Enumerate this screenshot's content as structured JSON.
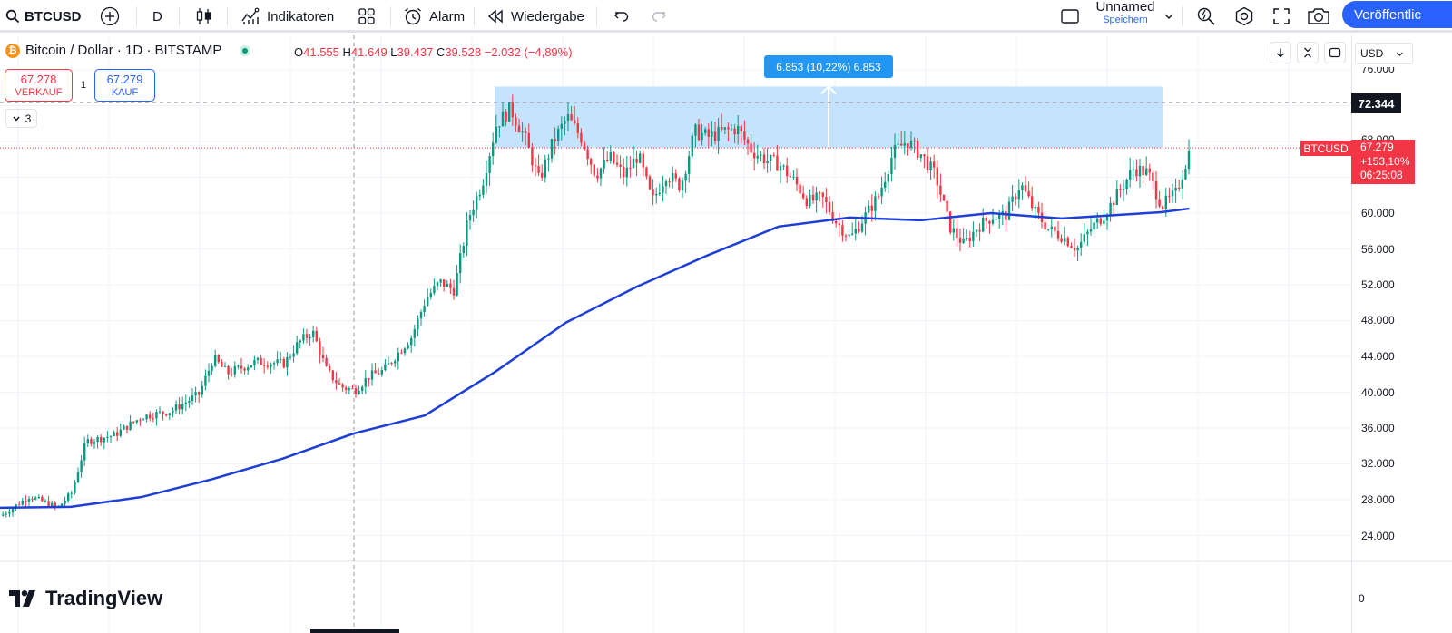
{
  "toolbar": {
    "symbol": "BTCUSD",
    "interval": "D",
    "indicators_label": "Indikatoren",
    "alarm_label": "Alarm",
    "replay_label": "Wiedergabe",
    "layout_name": "Unnamed",
    "layout_save_label": "Speichern",
    "publish_label": "Veröffentlic"
  },
  "legend": {
    "coin_glyph": "₿",
    "title": "Bitcoin / Dollar · 1D · BITSTAMP",
    "open_key": "O",
    "open": "41.555",
    "high_key": "H",
    "high": "41.649",
    "low_key": "L",
    "low": "39.437",
    "close_key": "C",
    "close": "39.528",
    "change": "−2.032 (−4,89%)"
  },
  "trade": {
    "sell_price": "67.278",
    "sell_label": "VERKAUF",
    "spread": "1",
    "buy_price": "67.279",
    "buy_label": "KAUF"
  },
  "indicator_count": "3",
  "measure_label": "6.853 (10,22%) 6.853",
  "currency": "USD",
  "price_axis": {
    "ticks": [
      "76.000",
      "68.000",
      "60.000",
      "56.000",
      "52.000",
      "48.000",
      "44.000",
      "40.000",
      "36.000",
      "32.000",
      "28.000",
      "24.000"
    ],
    "zero": "0",
    "crosshair_price": "72.344",
    "symbol_tag": "BTCUSD",
    "last_price": "67.279",
    "change_pct": "+153,10%",
    "countdown": "06:25:08"
  },
  "branding": "TradingView",
  "colors": {
    "up": "#089981",
    "down": "#f23645",
    "ma": "#1e3fd6",
    "measure_fill": "#bbdefb",
    "accent": "#2962ff"
  },
  "icons": [
    "search-icon",
    "plus-circle-icon",
    "candles-icon",
    "indicators-icon",
    "templates-icon",
    "alarm-icon",
    "replay-icon",
    "undo-icon",
    "redo-icon",
    "layout-icon",
    "chevron-down-icon",
    "quick-search-icon",
    "settings-icon",
    "fullscreen-icon",
    "camera-icon",
    "arrow-down-icon",
    "collapse-icon",
    "maximize-icon"
  ],
  "chart_data": {
    "type": "candlestick",
    "timeframe": "1D",
    "y_range": [
      20000,
      78000
    ],
    "price_lines": {
      "crosshair": 72344,
      "last": 67279
    },
    "measure_range": {
      "from": 67279,
      "to": 74132
    },
    "moving_average": [
      [
        0,
        27100
      ],
      [
        0.05,
        27200
      ],
      [
        0.1,
        28300
      ],
      [
        0.15,
        30300
      ],
      [
        0.2,
        32600
      ],
      [
        0.25,
        35400
      ],
      [
        0.3,
        37400
      ],
      [
        0.35,
        42300
      ],
      [
        0.4,
        47800
      ],
      [
        0.45,
        51800
      ],
      [
        0.5,
        55300
      ],
      [
        0.55,
        58500
      ],
      [
        0.6,
        59500
      ],
      [
        0.65,
        59200
      ],
      [
        0.7,
        60000
      ],
      [
        0.75,
        59400
      ],
      [
        0.8,
        59900
      ],
      [
        0.82,
        60100
      ],
      [
        0.84,
        60500
      ]
    ],
    "price_path": [
      [
        0,
        26200
      ],
      [
        0.02,
        28400
      ],
      [
        0.04,
        27100
      ],
      [
        0.05,
        28800
      ],
      [
        0.06,
        34500
      ],
      [
        0.08,
        35200
      ],
      [
        0.09,
        36300
      ],
      [
        0.1,
        37300
      ],
      [
        0.12,
        37900
      ],
      [
        0.14,
        39800
      ],
      [
        0.15,
        43800
      ],
      [
        0.16,
        42100
      ],
      [
        0.18,
        43400
      ],
      [
        0.2,
        43200
      ],
      [
        0.21,
        45500
      ],
      [
        0.22,
        46800
      ],
      [
        0.23,
        42400
      ],
      [
        0.24,
        40600
      ],
      [
        0.25,
        40200
      ],
      [
        0.26,
        41800
      ],
      [
        0.27,
        42400
      ],
      [
        0.29,
        46200
      ],
      [
        0.3,
        50400
      ],
      [
        0.31,
        52300
      ],
      [
        0.32,
        51400
      ],
      [
        0.33,
        59400
      ],
      [
        0.34,
        63400
      ],
      [
        0.35,
        70000
      ],
      [
        0.36,
        71600
      ],
      [
        0.37,
        68400
      ],
      [
        0.38,
        63600
      ],
      [
        0.39,
        68000
      ],
      [
        0.4,
        70700
      ],
      [
        0.41,
        68400
      ],
      [
        0.42,
        64300
      ],
      [
        0.43,
        66200
      ],
      [
        0.44,
        64200
      ],
      [
        0.45,
        66500
      ],
      [
        0.46,
        61300
      ],
      [
        0.47,
        64400
      ],
      [
        0.48,
        63000
      ],
      [
        0.49,
        69100
      ],
      [
        0.5,
        68500
      ],
      [
        0.51,
        69100
      ],
      [
        0.52,
        69500
      ],
      [
        0.53,
        67000
      ],
      [
        0.54,
        66000
      ],
      [
        0.55,
        65400
      ],
      [
        0.56,
        63600
      ],
      [
        0.57,
        61300
      ],
      [
        0.58,
        61700
      ],
      [
        0.59,
        59000
      ],
      [
        0.6,
        57200
      ],
      [
        0.61,
        59600
      ],
      [
        0.62,
        62000
      ],
      [
        0.63,
        66700
      ],
      [
        0.64,
        68100
      ],
      [
        0.65,
        66500
      ],
      [
        0.66,
        64200
      ],
      [
        0.67,
        58500
      ],
      [
        0.68,
        56500
      ],
      [
        0.69,
        58500
      ],
      [
        0.7,
        59600
      ],
      [
        0.71,
        59800
      ],
      [
        0.72,
        63300
      ],
      [
        0.73,
        60200
      ],
      [
        0.74,
        58200
      ],
      [
        0.75,
        57400
      ],
      [
        0.76,
        56000
      ],
      [
        0.77,
        58300
      ],
      [
        0.78,
        60000
      ],
      [
        0.79,
        62500
      ],
      [
        0.8,
        65000
      ],
      [
        0.81,
        64500
      ],
      [
        0.82,
        60800
      ],
      [
        0.83,
        62200
      ],
      [
        0.84,
        67280
      ]
    ]
  }
}
